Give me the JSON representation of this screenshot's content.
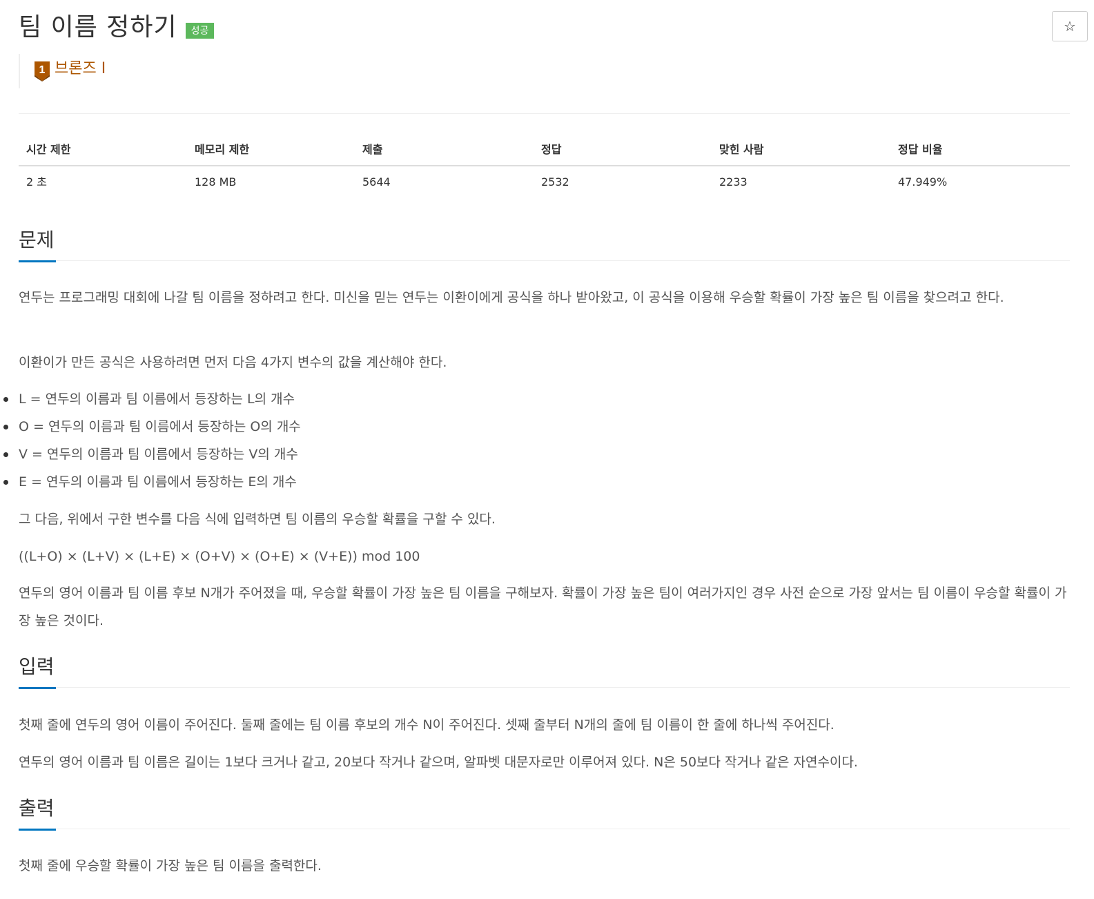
{
  "problem": {
    "title": "팀 이름 정하기",
    "status_badge": "성공",
    "tier_number": "1",
    "tier_label": "브론즈 I",
    "star_icon": "☆"
  },
  "stats": {
    "headers": [
      "시간 제한",
      "메모리 제한",
      "제출",
      "정답",
      "맞힌 사람",
      "정답 비율"
    ],
    "values": [
      "2 초",
      "128 MB",
      "5644",
      "2532",
      "2233",
      "47.949%"
    ]
  },
  "sections": {
    "description": {
      "title": "문제",
      "p1": "연두는 프로그래밍 대회에 나갈 팀 이름을 정하려고 한다. 미신을 믿는 연두는 이환이에게 공식을 하나 받아왔고, 이 공식을 이용해 우승할 확률이 가장 높은 팀 이름을 찾으려고 한다.",
      "p2": "이환이가 만든 공식은 사용하려면 먼저 다음 4가지 변수의 값을 계산해야 한다.",
      "bullets": [
        "L = 연두의 이름과 팀 이름에서 등장하는 L의 개수",
        "O = 연두의 이름과 팀 이름에서 등장하는 O의 개수",
        "V = 연두의 이름과 팀 이름에서 등장하는 V의 개수",
        "E = 연두의 이름과 팀 이름에서 등장하는 E의 개수"
      ],
      "p3": "그 다음, 위에서 구한 변수를 다음 식에 입력하면 팀 이름의 우승할 확률을 구할 수 있다.",
      "formula": "((L+O) × (L+V) × (L+E) × (O+V) × (O+E) × (V+E)) mod 100",
      "p4": "연두의 영어 이름과 팀 이름 후보 N개가 주어졌을 때, 우승할 확률이 가장 높은 팀 이름을 구해보자. 확률이 가장 높은 팀이 여러가지인 경우 사전 순으로 가장 앞서는 팀 이름이 우승할 확률이 가장 높은 것이다."
    },
    "input": {
      "title": "입력",
      "p1": "첫째 줄에 연두의 영어 이름이 주어진다. 둘째 줄에는 팀 이름 후보의 개수 N이 주어진다. 셋째 줄부터 N개의 줄에 팀 이름이 한 줄에 하나씩 주어진다.",
      "p2": "연두의 영어 이름과 팀 이름은 길이는 1보다 크거나 같고, 20보다 작거나 같으며, 알파벳 대문자로만 이루어져 있다. N은 50보다 작거나 같은 자연수이다."
    },
    "output": {
      "title": "출력",
      "p1": "첫째 줄에 우승할 확률이 가장 높은 팀 이름을 출력한다."
    }
  },
  "colors": {
    "badge_success": "#5cb85c",
    "tier_bronze": "#ad5600",
    "section_accent": "#0076c0"
  }
}
